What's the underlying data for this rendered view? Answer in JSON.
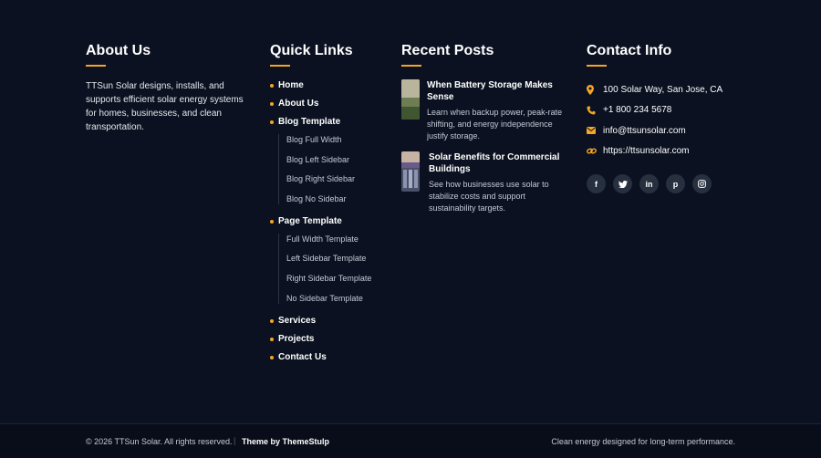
{
  "about": {
    "heading": "About Us",
    "text": "TTSun Solar designs, installs, and supports efficient solar energy systems for homes, businesses, and clean transportation."
  },
  "quick_links": {
    "heading": "Quick Links",
    "items": [
      {
        "label": "Home"
      },
      {
        "label": "About Us"
      },
      {
        "label": "Blog Template",
        "children": [
          "Blog Full Width",
          "Blog Left Sidebar",
          "Blog Right Sidebar",
          "Blog No Sidebar"
        ]
      },
      {
        "label": "Page Template",
        "children": [
          "Full Width Template",
          "Left Sidebar Template",
          "Right Sidebar Template",
          "No Sidebar Template"
        ]
      },
      {
        "label": "Services"
      },
      {
        "label": "Projects"
      },
      {
        "label": "Contact Us"
      }
    ]
  },
  "recent_posts": {
    "heading": "Recent Posts",
    "posts": [
      {
        "title": "When Battery Storage Makes Sense",
        "excerpt": "Learn when backup power, peak-rate shifting, and energy independence justify storage."
      },
      {
        "title": "Solar Benefits for Commercial Buildings",
        "excerpt": "See how businesses use solar to stabilize costs and support sustainability targets."
      }
    ]
  },
  "contact": {
    "heading": "Contact Info",
    "address": "100 Solar Way, San Jose, CA",
    "phone": "+1 800 234 5678",
    "email": "info@ttsunsolar.com",
    "website": "https://ttsunsolar.com",
    "socials": [
      {
        "name": "facebook",
        "glyph": "f"
      },
      {
        "name": "twitter",
        "glyph": "t"
      },
      {
        "name": "linkedin",
        "glyph": "in"
      },
      {
        "name": "pinterest",
        "glyph": "p"
      },
      {
        "name": "instagram",
        "glyph": "◎"
      }
    ]
  },
  "bottom": {
    "copyright": "© 2026 TTSun Solar. All rights reserved.",
    "separator": "|",
    "theme_credit": "Theme by ThemeStulp",
    "tagline": "Clean energy designed for long-term performance."
  },
  "colors": {
    "background": "#0b1120",
    "accent": "#f5a623",
    "social_bg": "#27303f"
  }
}
